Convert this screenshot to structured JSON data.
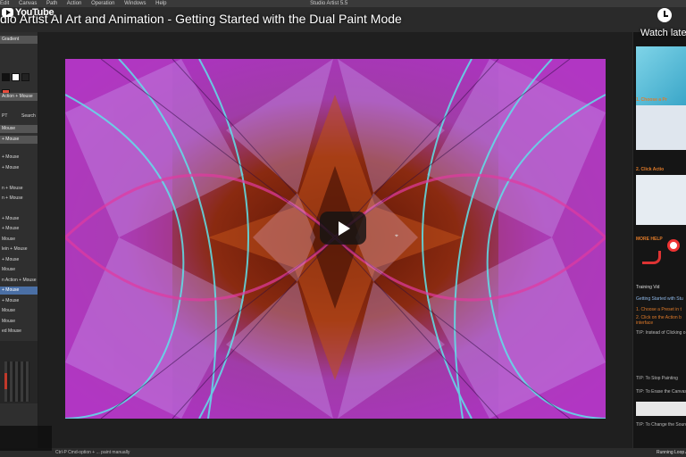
{
  "app": {
    "menu": [
      "Edit",
      "Canvas",
      "Path",
      "Action",
      "Operation",
      "Windows",
      "Help"
    ],
    "window_title": "Studio Artist 5.5"
  },
  "video": {
    "title": "dio Artist AI Art and Animation - Getting Started with the Dual Paint Mode",
    "watch_later_label": "Watch late",
    "youtube_label": "YouTube"
  },
  "left_panel": {
    "rows": [
      "Gradient",
      "Action + Mouse",
      "PT",
      "Search",
      "Mouse",
      "+ Mouse",
      "+ Mouse",
      "+ Mouse",
      "n + Mouse",
      "n + Mouse",
      "+ Mouse",
      "+ Mouse",
      "Mouse",
      "lein + Mouse",
      "+ Mouse",
      "Mouse",
      "n Action + Mouse",
      "+ Mouse",
      "+ Mouse",
      "Mouse",
      "Mouse",
      "ed Mouse"
    ],
    "swatch_colors": [
      "#111111",
      "#ffffff",
      "#222222",
      "#e74c3c"
    ]
  },
  "right_panel": {
    "step1": "1. Choose a Pr",
    "step2": "2. Click Actio",
    "more_help": "MORE HELP",
    "training": "Training Vid",
    "getting_started": "Getting Started with Stu",
    "item1": "1. Choose a Preset in t",
    "item2": "2. Click on the Action b",
    "item2b": "interface",
    "tip1": "TIP: Instead of Clicking o",
    "tip2": "TIP: To Stop Painting",
    "tip3": "TIP: To Erase the Canvas",
    "tip4": "TIP: To Change the Source",
    "status": "Running Loop A"
  },
  "status_bar": {
    "left": "Ctrl-P Cmd-option + ... paint manually"
  },
  "colors": {
    "accent_red": "#e52d27",
    "panel_dark": "#2f2f2f",
    "help_orange": "#e07b2a"
  }
}
